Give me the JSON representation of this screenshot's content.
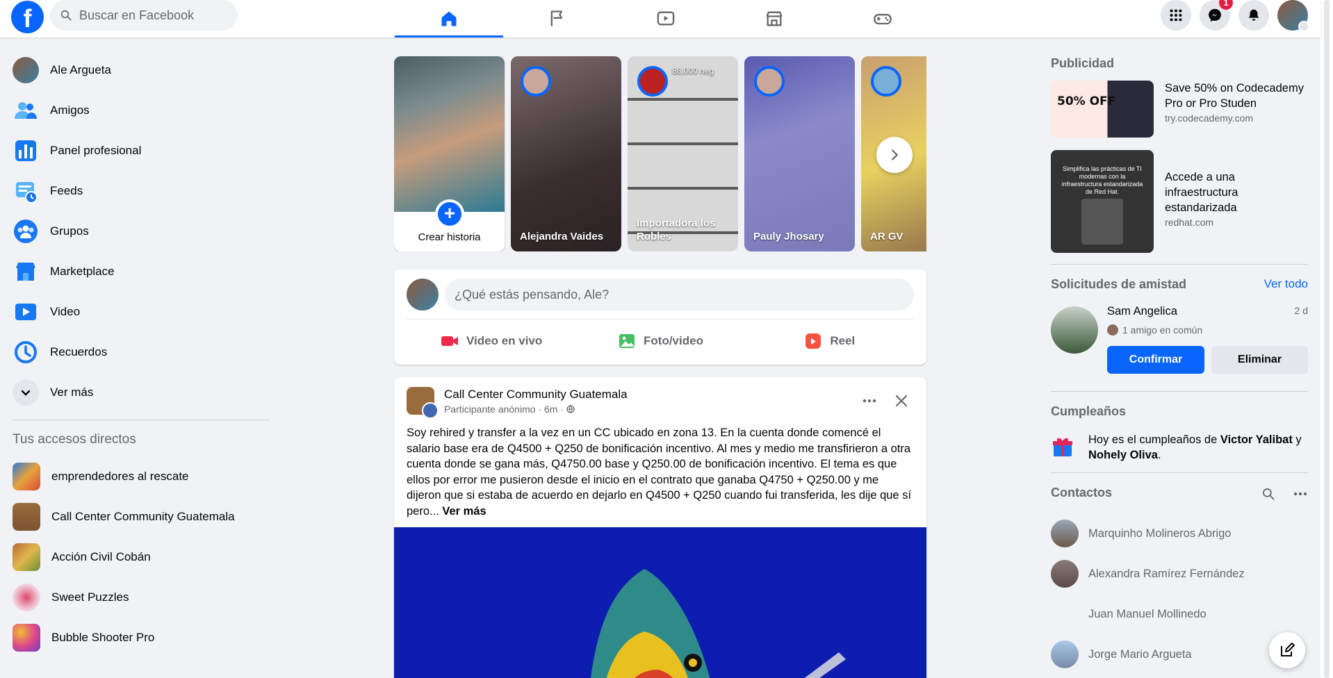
{
  "header": {
    "logo": "f",
    "search_placeholder": "Buscar en Facebook",
    "nav_tabs": [
      "home-icon",
      "flag-icon",
      "video-icon",
      "marketplace-icon",
      "gaming-icon"
    ],
    "notifications_badge": "1"
  },
  "sidebar": {
    "items": [
      {
        "label": "Ale Argueta",
        "icon": "avatar"
      },
      {
        "label": "Amigos",
        "icon": "friends-icon"
      },
      {
        "label": "Panel profesional",
        "icon": "dashboard-icon"
      },
      {
        "label": "Feeds",
        "icon": "feeds-icon"
      },
      {
        "label": "Grupos",
        "icon": "groups-icon"
      },
      {
        "label": "Marketplace",
        "icon": "marketplace-icon"
      },
      {
        "label": "Video",
        "icon": "video-icon"
      },
      {
        "label": "Recuerdos",
        "icon": "memories-icon"
      },
      {
        "label": "Ver más",
        "icon": "chevron-down-icon"
      }
    ],
    "shortcuts_title": "Tus accesos directos",
    "shortcuts": [
      {
        "label": "emprendedores al rescate"
      },
      {
        "label": "Call Center Community Guatemala"
      },
      {
        "label": "Acción Civil Cobán"
      },
      {
        "label": "Sweet Puzzles"
      },
      {
        "label": "Bubble Shooter Pro"
      }
    ]
  },
  "stories": {
    "create_label": "Crear historia",
    "items": [
      {
        "name": "Alejandra Vaides"
      },
      {
        "name": "Importadora los Robles",
        "caption": "88,000 neg"
      },
      {
        "name": "Pauly Jhosary"
      },
      {
        "name": "AR GV"
      }
    ]
  },
  "composer": {
    "placeholder": "¿Qué estás pensando, Ale?",
    "actions": [
      "Video en vivo",
      "Foto/video",
      "Reel"
    ]
  },
  "post": {
    "group": "Call Center Community Guatemala",
    "meta": "Participante anónimo · 6m ·",
    "text": "Soy rehired y transfer a la vez en un CC ubicado en zona 13.  En la cuenta donde comencé el salario base era de Q4500 + Q250 de bonificación incentivo.  Al mes y medio me transfirieron a otra cuenta donde se gana más, Q4750.00 base y Q250.00 de bonificación incentivo.  El tema es que ellos por error me pusieron desde el inicio en el contrato que ganaba Q4750 + Q250.00 y me dijeron que si estaba de acuerdo en dejarlo en Q4500 + Q250 cuando fui transferida, les dije que sí pero...",
    "see_more": "Ver más"
  },
  "right": {
    "ads_title": "Publicidad",
    "ads": [
      {
        "title": "Save 50% on Codecademy Pro or Pro Studen",
        "url": "try.codecademy.com",
        "image_text": "50% OFF"
      },
      {
        "title": "Accede a una infraestructura estandarizada",
        "url": "redhat.com",
        "image_text": "Simplifica las prácticas de TI modernas con la infraestructura estandarizada de Red Hat."
      }
    ],
    "friend_requests_title": "Solicitudes de amistad",
    "see_all": "Ver todo",
    "request": {
      "name": "Sam Angelica",
      "time": "2 d",
      "mutual": "1 amigo en común",
      "confirm": "Confirmar",
      "delete": "Eliminar"
    },
    "birthdays_title": "Cumpleaños",
    "birthday_prefix": "Hoy es el cumpleaños de",
    "birthday_name1": "Victor Yalibat",
    "birthday_and": "y",
    "birthday_name2": "Nohely Oliva",
    "birthday_end": ".",
    "contacts_title": "Contactos",
    "contacts": [
      {
        "name": "Marquinho Molineros Abrigo"
      },
      {
        "name": "Alexandra Ramírez Fernández"
      },
      {
        "name": "Juan Manuel Mollinedo"
      },
      {
        "name": "Jorge Mario Argueta"
      }
    ]
  },
  "colors": {
    "brand": "#0866ff",
    "bg": "#f0f2f5",
    "badge": "#e41e3f"
  }
}
